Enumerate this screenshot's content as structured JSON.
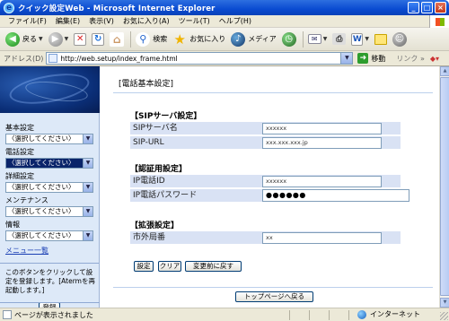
{
  "window": {
    "title": "クイック設定Web - Microsoft Internet Explorer",
    "minimize": "_",
    "maximize": "□",
    "close": "×"
  },
  "menu": [
    "ファイル(F)",
    "編集(E)",
    "表示(V)",
    "お気に入り(A)",
    "ツール(T)",
    "ヘルプ(H)"
  ],
  "toolbar": {
    "back_label": "戻る",
    "search_label": "検索",
    "favorites_label": "お気に入り",
    "media_label": "メディア"
  },
  "address": {
    "label": "アドレス(D)",
    "url": "http://web.setup/index_frame.html",
    "go_label": "移動",
    "links_label": "リンク",
    "links_arrow": "»"
  },
  "sidebar": {
    "groups": [
      {
        "label": "基本設定",
        "value": "〈選択してください〉",
        "selected": false
      },
      {
        "label": "電話設定",
        "value": "〈選択してください〉",
        "selected": true
      },
      {
        "label": "詳細設定",
        "value": "〈選択してください〉",
        "selected": false
      },
      {
        "label": "メンテナンス",
        "value": "〈選択してください〉",
        "selected": false
      },
      {
        "label": "情報",
        "value": "〈選択してください〉",
        "selected": false
      }
    ],
    "menu_link": "メニュー一覧",
    "help_text": "このボタンをクリックして設定を登録します。[Atermを再起動します。]",
    "register_button": "登録"
  },
  "main": {
    "page_title": "[電話基本設定]",
    "sections": [
      {
        "heading": "【SIPサーバ設定】",
        "rows": [
          {
            "label": "SIPサーバ名",
            "value": "xxxxxx"
          },
          {
            "label": "SIP-URL",
            "value": "xxx.xxx.xxx.jp"
          }
        ]
      },
      {
        "heading": "【認証用設定】",
        "rows": [
          {
            "label": "IP電話ID",
            "value": "xxxxxx"
          },
          {
            "label": "IP電話パスワード",
            "value": "●●●●●●"
          }
        ]
      },
      {
        "heading": "【拡張設定】",
        "rows": [
          {
            "label": "市外局番",
            "value": "xx"
          }
        ]
      }
    ],
    "buttons": {
      "set": "設定",
      "clear": "クリア",
      "revert": "変更前に戻す",
      "top_page": "トップページへ戻る"
    }
  },
  "status": {
    "text": "ページが表示されました",
    "zone": "インターネット"
  },
  "colors": {
    "titlebar": "#0a4bd1",
    "sidebar_bg": "#dde9f8",
    "row_bg": "#d9e2f4",
    "selected_select": "#0a246a",
    "link": "#1a3fb4"
  }
}
